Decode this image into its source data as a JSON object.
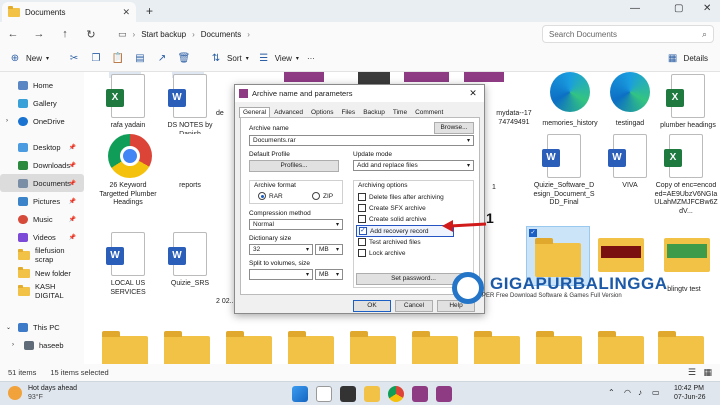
{
  "window": {
    "tab_title": "Documents",
    "new_tab": "+"
  },
  "address": {
    "path_items": [
      "Start backup",
      "Documents"
    ],
    "search_placeholder": "Search Documents"
  },
  "commandbar": {
    "new_label": "New",
    "sort_label": "Sort",
    "view_label": "View",
    "more_label": "···",
    "details_label": "Details"
  },
  "sidebar": {
    "top": [
      "Home",
      "Gallery",
      "OneDrive"
    ],
    "pinned": [
      "Desktop",
      "Downloads",
      "Documents",
      "Pictures",
      "Music",
      "Videos",
      "filefusion scrap",
      "New folder",
      "KASH DIGITAL"
    ],
    "bottom": [
      "This PC",
      "haseeb"
    ]
  },
  "files": [
    {
      "name": "rafa yadain",
      "type": "word"
    },
    {
      "name": "DS NOTES by Danish",
      "type": "word"
    },
    {
      "name": "de",
      "type": "folder"
    },
    {
      "name": "mydata--17 74749491",
      "type": "folder"
    },
    {
      "name": "memories_history",
      "type": "edge"
    },
    {
      "name": "testingad",
      "type": "edge"
    },
    {
      "name": "plumber headings",
      "type": "excel"
    },
    {
      "name": "26 Keyword Targetted Plumber Headings",
      "type": "chrome"
    },
    {
      "name": "reports",
      "type": "folder-plain"
    },
    {
      "name": "1",
      "type": "folder"
    },
    {
      "name": "Quizie_Software_Design_Document_SDD_Final",
      "type": "word"
    },
    {
      "name": "VIVA",
      "type": "word"
    },
    {
      "name": "Copy of enc=encoded=AE9UbzV6NGIaULahMZMJFCBw6ZdV...",
      "type": "excel"
    },
    {
      "name": "LOCAL US SERVICES",
      "type": "word"
    },
    {
      "name": "Quizie_SRS",
      "type": "word"
    },
    {
      "name": "2 02...",
      "type": "folder"
    },
    {
      "name": "blingtv test",
      "type": "folder"
    }
  ],
  "dialog": {
    "title": "Archive name and parameters",
    "tabs": [
      "General",
      "Advanced",
      "Options",
      "Files",
      "Backup",
      "Time",
      "Comment"
    ],
    "archive_name_label": "Archive name",
    "archive_name_value": "Documents.rar",
    "browse_label": "Browse...",
    "default_profile_label": "Default Profile",
    "profiles_label": "Profiles...",
    "update_mode_label": "Update mode",
    "update_mode_value": "Add and replace files",
    "archive_format_label": "Archive format",
    "format_rar": "RAR",
    "format_zip": "ZIP",
    "archiving_options_label": "Archiving options",
    "options": [
      {
        "label": "Delete files after archiving",
        "checked": false
      },
      {
        "label": "Create SFX archive",
        "checked": false
      },
      {
        "label": "Create solid archive",
        "checked": false
      },
      {
        "label": "Add recovery record",
        "checked": true
      },
      {
        "label": "Test archived files",
        "checked": false
      },
      {
        "label": "Lock archive",
        "checked": false
      }
    ],
    "compression_method_label": "Compression method",
    "compression_method_value": "Normal",
    "dictionary_size_label": "Dictionary size",
    "dictionary_size_value": "32",
    "dictionary_unit": "MB",
    "split_label": "Split to volumes, size",
    "split_unit": "MB",
    "set_password_label": "Set password...",
    "ok_label": "OK",
    "cancel_label": "Cancel",
    "help_label": "Help"
  },
  "annotation": {
    "number": "1"
  },
  "watermark": {
    "brand": "GIGAPURBALINGGA",
    "tagline": "PER Free Download Software & Games Full Version"
  },
  "status": {
    "items_count": "51 items",
    "selected": "15 items selected"
  },
  "taskbar": {
    "weather_title": "Hot days ahead",
    "weather_temp": "93°F",
    "time": "10:42 PM",
    "date": "07-Jun-26"
  },
  "colors": {
    "accent": "#1b5fc5",
    "arrow": "#d11a1a",
    "folder": "#f2c246"
  }
}
